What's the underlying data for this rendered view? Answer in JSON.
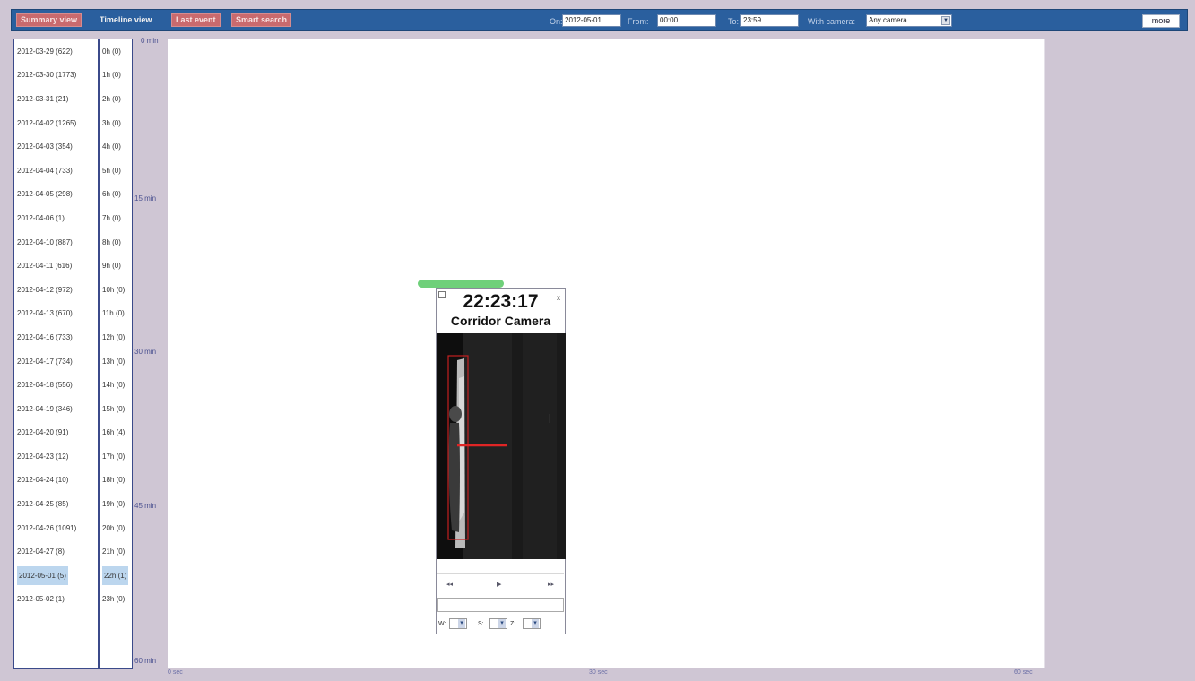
{
  "nav": {
    "summary_label": "Summary view",
    "timeline_label": "Timeline view",
    "last_event_label": "Last event",
    "smart_search_label": "Smart search"
  },
  "filters": {
    "on_label": "On:",
    "on_value": "2012-05-01",
    "from_label": "From:",
    "from_value": "00:00",
    "to_label": "To:",
    "to_value": "23:59",
    "camera_label": "With camera:",
    "camera_value": "Any camera"
  },
  "more_label": "more",
  "dates": [
    "2012-03-29 (622)",
    "2012-03-30 (1773)",
    "2012-03-31 (21)",
    "2012-04-02 (1265)",
    "2012-04-03 (354)",
    "2012-04-04 (733)",
    "2012-04-05 (298)",
    "2012-04-06 (1)",
    "2012-04-10 (887)",
    "2012-04-11 (616)",
    "2012-04-12 (972)",
    "2012-04-13 (670)",
    "2012-04-16 (733)",
    "2012-04-17 (734)",
    "2012-04-18 (556)",
    "2012-04-19 (346)",
    "2012-04-20 (91)",
    "2012-04-23 (12)",
    "2012-04-24 (10)",
    "2012-04-25 (85)",
    "2012-04-26 (1091)",
    "2012-04-27 (8)",
    "2012-05-01 (5)",
    "2012-05-02 (1)"
  ],
  "selected_date_index": 22,
  "hours": [
    "0h (0)",
    "1h (0)",
    "2h (0)",
    "3h (0)",
    "4h (0)",
    "5h (0)",
    "6h (0)",
    "7h (0)",
    "8h (0)",
    "9h (0)",
    "10h (0)",
    "11h (0)",
    "12h (0)",
    "13h (0)",
    "14h (0)",
    "15h (0)",
    "16h (4)",
    "17h (0)",
    "18h (0)",
    "19h (0)",
    "20h (0)",
    "21h (0)",
    "22h (1)",
    "23h (0)"
  ],
  "selected_hour_index": 22,
  "minute_axis": [
    "0 min",
    "15 min",
    "30 min",
    "45 min",
    "60 min"
  ],
  "second_axis": [
    "0 sec",
    "30 sec",
    "60 sec"
  ],
  "event": {
    "time": "22:23:17",
    "camera": "Corridor Camera",
    "close": "x",
    "prev": "◂◂",
    "play": "▶",
    "next": "▸▸",
    "sel_labels": [
      "W:",
      "S:",
      "Z:"
    ]
  },
  "colors": {
    "topbar": "#2a5f9e",
    "tab_active": "#c96a6e",
    "selection": "#bcd6ee",
    "event_bar": "#6fd07a",
    "motion_box": "#e02525"
  }
}
